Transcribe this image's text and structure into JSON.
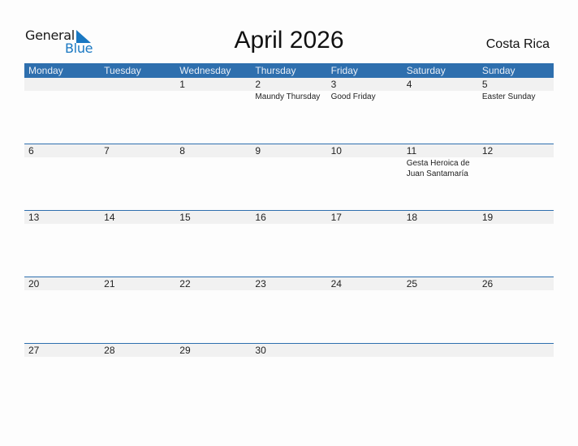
{
  "logo": {
    "word1": "General",
    "word2": "Blue"
  },
  "title": "April 2026",
  "country": "Costa Rica",
  "weekdays": [
    "Monday",
    "Tuesday",
    "Wednesday",
    "Thursday",
    "Friday",
    "Saturday",
    "Sunday"
  ],
  "weeks": [
    {
      "days": [
        "",
        "",
        "1",
        "2",
        "3",
        "4",
        "5"
      ],
      "events": [
        "",
        "",
        "",
        "Maundy Thursday",
        "Good Friday",
        "",
        "Easter Sunday"
      ]
    },
    {
      "days": [
        "6",
        "7",
        "8",
        "9",
        "10",
        "11",
        "12"
      ],
      "events": [
        "",
        "",
        "",
        "",
        "",
        "Gesta Heroica de Juan Santamaría",
        ""
      ]
    },
    {
      "days": [
        "13",
        "14",
        "15",
        "16",
        "17",
        "18",
        "19"
      ],
      "events": [
        "",
        "",
        "",
        "",
        "",
        "",
        ""
      ]
    },
    {
      "days": [
        "20",
        "21",
        "22",
        "23",
        "24",
        "25",
        "26"
      ],
      "events": [
        "",
        "",
        "",
        "",
        "",
        "",
        ""
      ]
    },
    {
      "days": [
        "27",
        "28",
        "29",
        "30",
        "",
        "",
        ""
      ],
      "events": [
        "",
        "",
        "",
        "",
        "",
        "",
        ""
      ]
    }
  ],
  "colors": {
    "header_bg": "#2e6fae",
    "brand_blue": "#1a78c2",
    "date_row_bg": "#f1f1f1"
  }
}
